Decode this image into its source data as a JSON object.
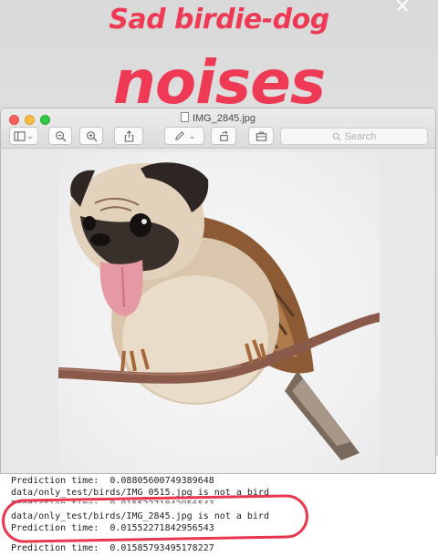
{
  "story": {
    "caption_line1": "Sad birdie-dog",
    "caption_line2": "noises",
    "close_glyph": "×"
  },
  "window": {
    "title": "IMG_2845.jpg",
    "toolbar": {
      "sidebar_toggle_icon": "sidebar-icon",
      "sidebar_toggle_menu": "⌄",
      "zoom_out_icon": "zoom-out-icon",
      "zoom_in_icon": "zoom-in-icon",
      "share_icon": "share-icon",
      "markup_icon": "pen-icon",
      "markup_menu": "⌄",
      "rotate_icon": "rotate-icon",
      "toolbox_icon": "toolbox-icon"
    },
    "search_placeholder": "Search",
    "image_subject": "pug-headed sparrow on branch"
  },
  "terminal": {
    "lines": [
      "Prediction time:  0.08805600749389648",
      "data/only_test/birds/IMG_0515.jpg is not a bird",
      "Prediction time:  0.01552271842956543",
      "data/only_test/birds/IMG_2845.jpg is not a bird",
      "Prediction time:  0.01552271842956543",
      "Prediction time:  0.01585793495178227"
    ]
  },
  "colors": {
    "caption": "#ee3a55",
    "ring": "#e8374f",
    "traffic_close": "#fc605c",
    "traffic_min": "#fdbc40",
    "traffic_max": "#34c84a"
  }
}
